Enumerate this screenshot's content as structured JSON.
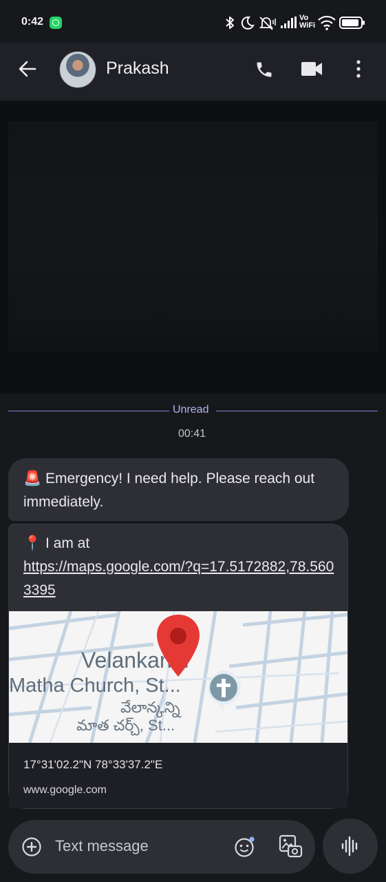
{
  "status_bar": {
    "time": "0:42",
    "network_label": "Vo WiFi",
    "icons": [
      "whatsapp-icon",
      "bluetooth-icon",
      "do-not-disturb-icon",
      "mute-icon",
      "signal-icon",
      "vowifi-icon",
      "wifi-icon",
      "battery-icon"
    ]
  },
  "header": {
    "contact_name": "Prakash",
    "icons": [
      "back-arrow-icon",
      "phone-icon",
      "video-call-icon",
      "more-vert-icon"
    ]
  },
  "conversation": {
    "unread_label": "Unread",
    "timestamp": "00:41",
    "messages": [
      {
        "emoji": "🚨",
        "text": "Emergency! I need help. Please reach out immediately."
      },
      {
        "emoji": "📍",
        "prefix": "I am at",
        "link": "https://maps.google.com/?q=17.5172882,78.5603395",
        "preview": {
          "map_label_en_1": "Velankanni",
          "map_label_en_2": "Matha Church, St...",
          "map_label_te_1": "వేలాన్కన్ని",
          "map_label_te_2": "మాత చర్చ్, St...",
          "coordinates": "17°31'02.2\"N 78°33'37.2\"E",
          "domain": "www.google.com"
        }
      }
    ]
  },
  "composer": {
    "placeholder": "Text message",
    "icons": [
      "add-icon",
      "emoji-icon",
      "gallery-icon",
      "voice-icon"
    ]
  },
  "colors": {
    "background": "#17181c",
    "bubble": "#2e2f35",
    "accent": "#7d89d6",
    "map_pin": "#e53935"
  }
}
